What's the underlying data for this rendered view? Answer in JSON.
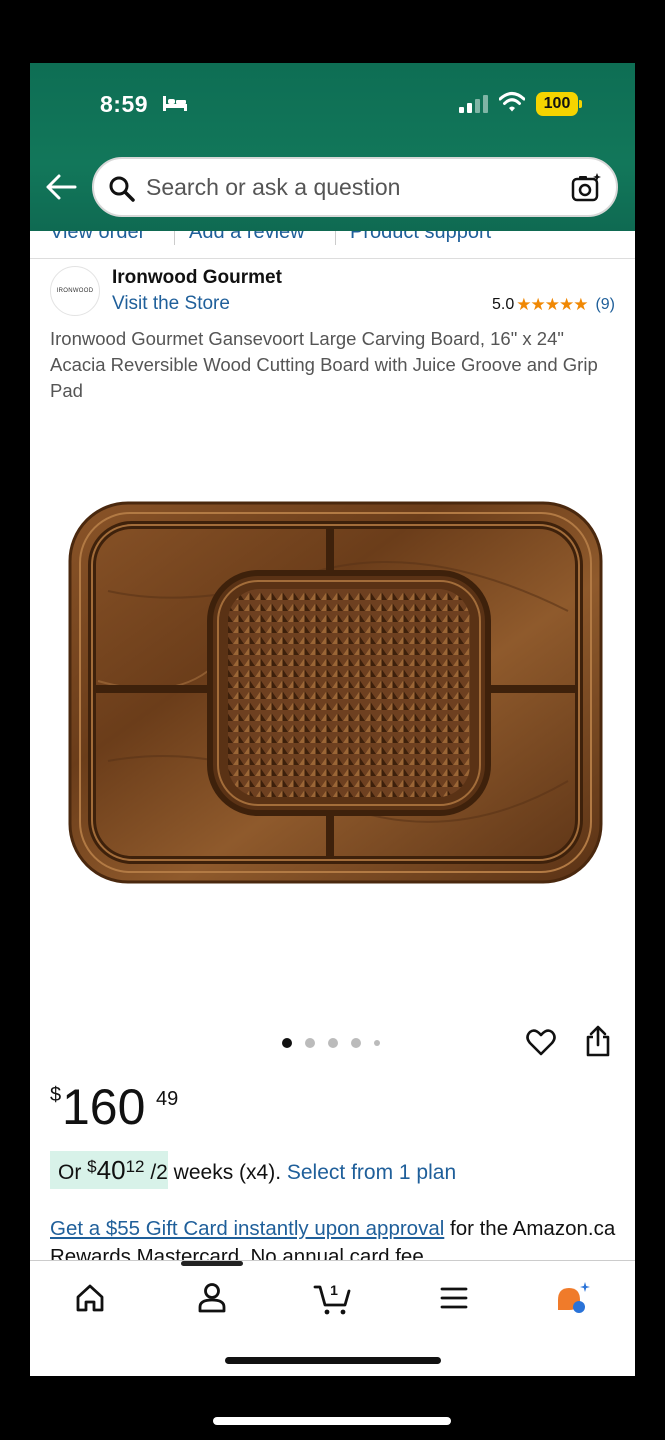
{
  "status_bar": {
    "time": "8:59",
    "battery": "100"
  },
  "search": {
    "placeholder": "Search or ask a question"
  },
  "subnav": {
    "items": [
      "View order",
      "Add a review",
      "Product support"
    ]
  },
  "brand": {
    "logo_text": "IRONWOOD",
    "name": "Ironwood Gourmet",
    "store_link": "Visit the Store",
    "rating": "5.0",
    "stars": "★★★★★",
    "rating_count": "(9)"
  },
  "product": {
    "title": "Ironwood Gourmet Gansevoort Large Carving Board, 16\" x 24\" Acacia Reversible Wood Cutting Board with Juice Groove and Grip Pad",
    "image_count": 5,
    "active_image": 1
  },
  "price": {
    "symbol": "$",
    "whole": "160",
    "fraction": "49"
  },
  "installment": {
    "prefix": "Or ",
    "symbol": "$",
    "whole": "40",
    "fraction": "12",
    "suffix": " /2 weeks (x4). ",
    "link": "Select from 1 plan"
  },
  "gift_offer": {
    "link": "Get a $55 Gift Card instantly upon approval",
    "text": " for the Amazon.ca Rewards Mastercard. No annual card fee."
  },
  "bottom_nav": {
    "items": [
      "home-icon",
      "account-icon",
      "cart-icon",
      "menu-icon",
      "rufus-icon"
    ],
    "cart_count": "1"
  },
  "colors": {
    "header_green": "#12775a",
    "link_blue": "#1f5f9a",
    "star_orange": "#f08804",
    "installment_bg": "#d8f2e9"
  }
}
